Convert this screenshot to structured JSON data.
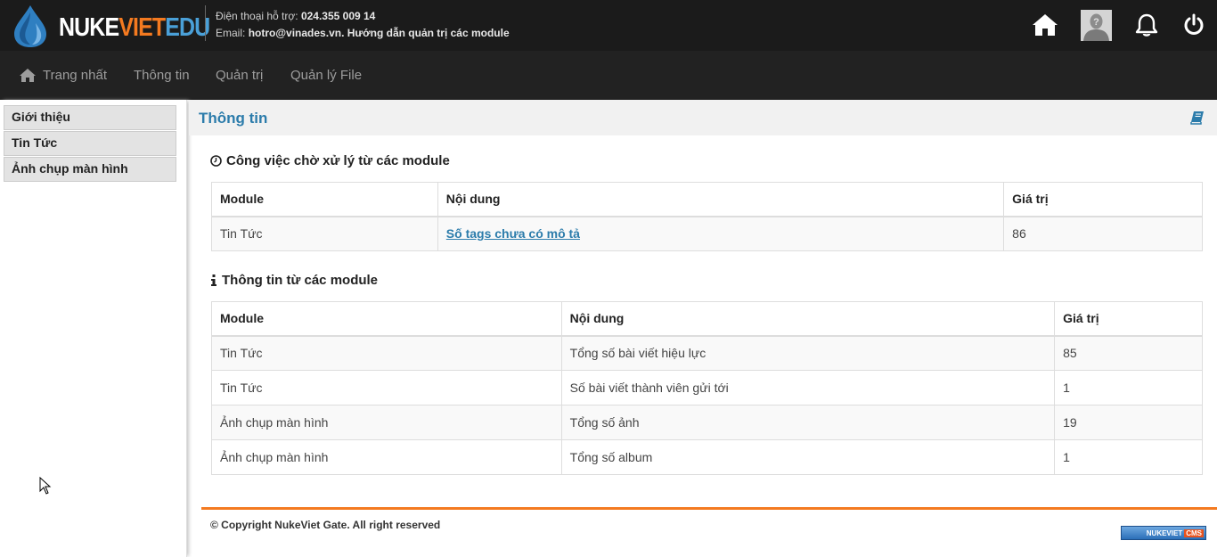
{
  "brand": {
    "part1": "NUKE",
    "part2": "VIET",
    "part3": "EDU"
  },
  "support": {
    "phone_label": "Điện thoại hỗ trợ:",
    "phone": "024.355 009 14",
    "email_label": "Email:",
    "email_line": "hotro@vinades.vn. Hướng dẫn quản trị các module"
  },
  "header_icons": [
    "home-icon",
    "avatar",
    "bell-icon",
    "power-icon"
  ],
  "nav": {
    "items": [
      {
        "label": "Trang nhất",
        "icon": "home-icon"
      },
      {
        "label": "Thông tin"
      },
      {
        "label": "Quản trị"
      },
      {
        "label": "Quản lý File"
      }
    ]
  },
  "sidebar": {
    "items": [
      {
        "label": "Giới thiệu"
      },
      {
        "label": "Tin Tức"
      },
      {
        "label": "Ảnh chụp màn hình"
      }
    ]
  },
  "main": {
    "title": "Thông tin",
    "pending": {
      "heading": "Công việc chờ xử lý từ các module",
      "icon": "clock-icon",
      "columns": [
        "Module",
        "Nội dung",
        "Giá trị"
      ],
      "rows": [
        {
          "module": "Tin Tức",
          "content": "Số tags chưa có mô tả",
          "value": "86"
        }
      ]
    },
    "info": {
      "heading": "Thông tin từ các module",
      "icon": "info-icon",
      "columns": [
        "Module",
        "Nội dung",
        "Giá trị"
      ],
      "rows": [
        {
          "module": "Tin Tức",
          "content": "Tổng số bài viết hiệu lực",
          "value": "85"
        },
        {
          "module": "Tin Tức",
          "content": "Số bài viết thành viên gửi tới",
          "value": "1"
        },
        {
          "module": "Ảnh chụp màn hình",
          "content": "Tổng số ảnh",
          "value": "19"
        },
        {
          "module": "Ảnh chụp màn hình",
          "content": "Tổng số album",
          "value": "1"
        }
      ]
    }
  },
  "footer": {
    "copyright": "© Copyright NukeViet Gate. All right reserved",
    "badge_left": "NUKEVIET",
    "badge_right": "CMS"
  },
  "colors": {
    "header_bg": "#1b1b1b",
    "nav_bg": "#222222",
    "accent": "#f47a20",
    "link": "#2c7cab"
  }
}
